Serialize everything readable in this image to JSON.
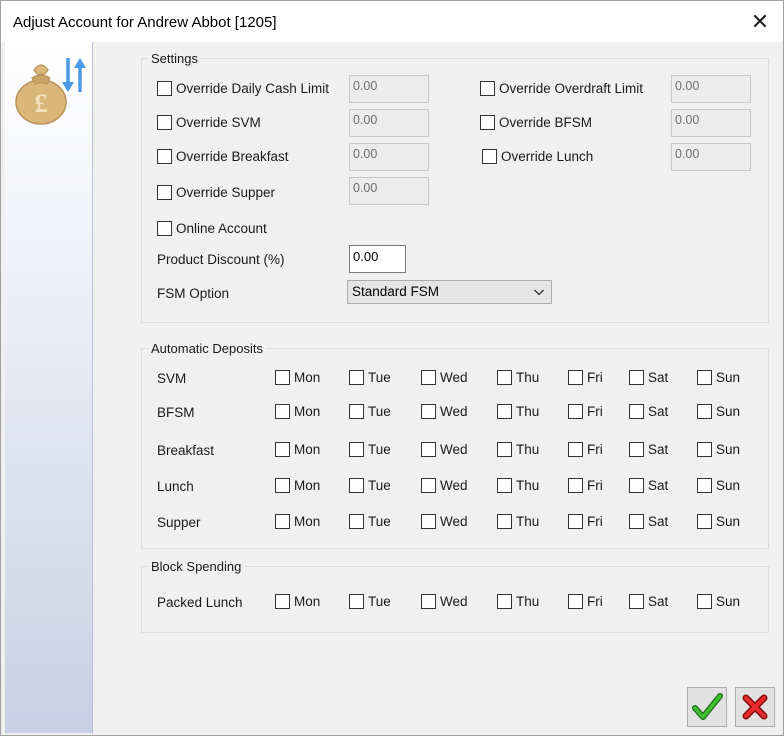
{
  "window": {
    "title": "Adjust Account for Andrew Abbot [1205]",
    "close_glyph": "✕"
  },
  "sidebar": {
    "icon": "money-bag-transfer-icon"
  },
  "settings": {
    "legend": "Settings",
    "override_daily_cash_limit": {
      "label": "Override Daily Cash Limit",
      "value": "0.00",
      "checked": false
    },
    "override_overdraft_limit": {
      "label": "Override Overdraft Limit",
      "value": "0.00",
      "checked": false
    },
    "override_svm": {
      "label": "Override SVM",
      "value": "0.00",
      "checked": false
    },
    "override_bfsm": {
      "label": "Override BFSM",
      "value": "0.00",
      "checked": false
    },
    "override_breakfast": {
      "label": "Override Breakfast",
      "value": "0.00",
      "checked": false
    },
    "override_lunch": {
      "label": "Override Lunch",
      "value": "0.00",
      "checked": false
    },
    "override_supper": {
      "label": "Override Supper",
      "value": "0.00",
      "checked": false
    },
    "online_account": {
      "label": "Online Account",
      "checked": false
    },
    "product_discount": {
      "label": "Product Discount (%)",
      "value": "0.00"
    },
    "fsm_option": {
      "label": "FSM Option",
      "selected": "Standard FSM"
    }
  },
  "days": [
    "Mon",
    "Tue",
    "Wed",
    "Thu",
    "Fri",
    "Sat",
    "Sun"
  ],
  "automatic_deposits": {
    "legend": "Automatic Deposits",
    "rows": [
      {
        "label": "SVM"
      },
      {
        "label": "BFSM"
      },
      {
        "label": "Breakfast"
      },
      {
        "label": "Lunch"
      },
      {
        "label": "Supper"
      }
    ]
  },
  "block_spending": {
    "legend": "Block Spending",
    "rows": [
      {
        "label": "Packed Lunch"
      }
    ]
  },
  "buttons": {
    "ok": {
      "icon": "green-checkmark-icon"
    },
    "cancel": {
      "icon": "red-x-icon"
    }
  },
  "colors": {
    "ok_green": "#2e9b22",
    "cancel_red": "#d32020",
    "arrow_blue": "#4c9be8",
    "bag_tan": "#d9b77a"
  }
}
